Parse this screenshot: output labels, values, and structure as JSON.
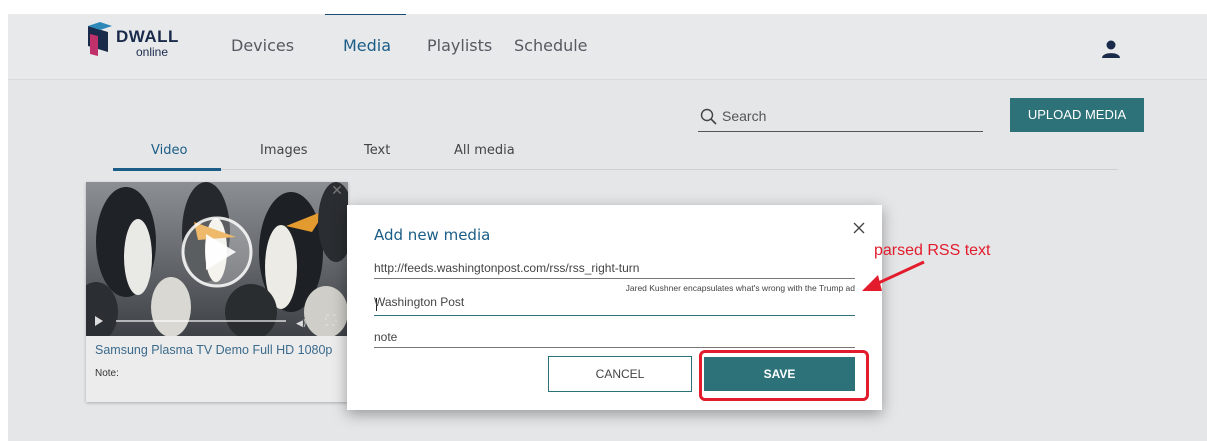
{
  "app": {
    "logo": {
      "word": "DWALL",
      "sub": "online"
    },
    "nav": [
      {
        "label": "Devices",
        "active": false
      },
      {
        "label": "Media",
        "active": true
      },
      {
        "label": "Playlists",
        "active": false
      },
      {
        "label": "Schedule",
        "active": false
      }
    ],
    "user_icon": "user-icon"
  },
  "toolbar": {
    "search_placeholder": "Search",
    "upload_label": "UPLOAD MEDIA"
  },
  "tabs": [
    {
      "label": "Video",
      "active": true
    },
    {
      "label": "Images",
      "active": false
    },
    {
      "label": "Text",
      "active": false
    },
    {
      "label": "All media",
      "active": false
    }
  ],
  "media_card": {
    "title": "Samsung Plasma TV Demo Full HD 1080p",
    "note_label": "Note:"
  },
  "modal": {
    "title": "Add new media",
    "url_value": "http://feeds.washingtonpost.com/rss/rss_right-turn",
    "rss_preview": "Jared Kushner encapsulates what's wrong with the Trump ad",
    "name_value": "Washington Post",
    "note_placeholder": "note",
    "cancel_label": "CANCEL",
    "save_label": "SAVE"
  },
  "annotation": {
    "text": "parsed RSS text"
  },
  "colors": {
    "accent": "#2d7279",
    "nav_active": "#1b5d86",
    "annotation": "#e21c2c"
  }
}
